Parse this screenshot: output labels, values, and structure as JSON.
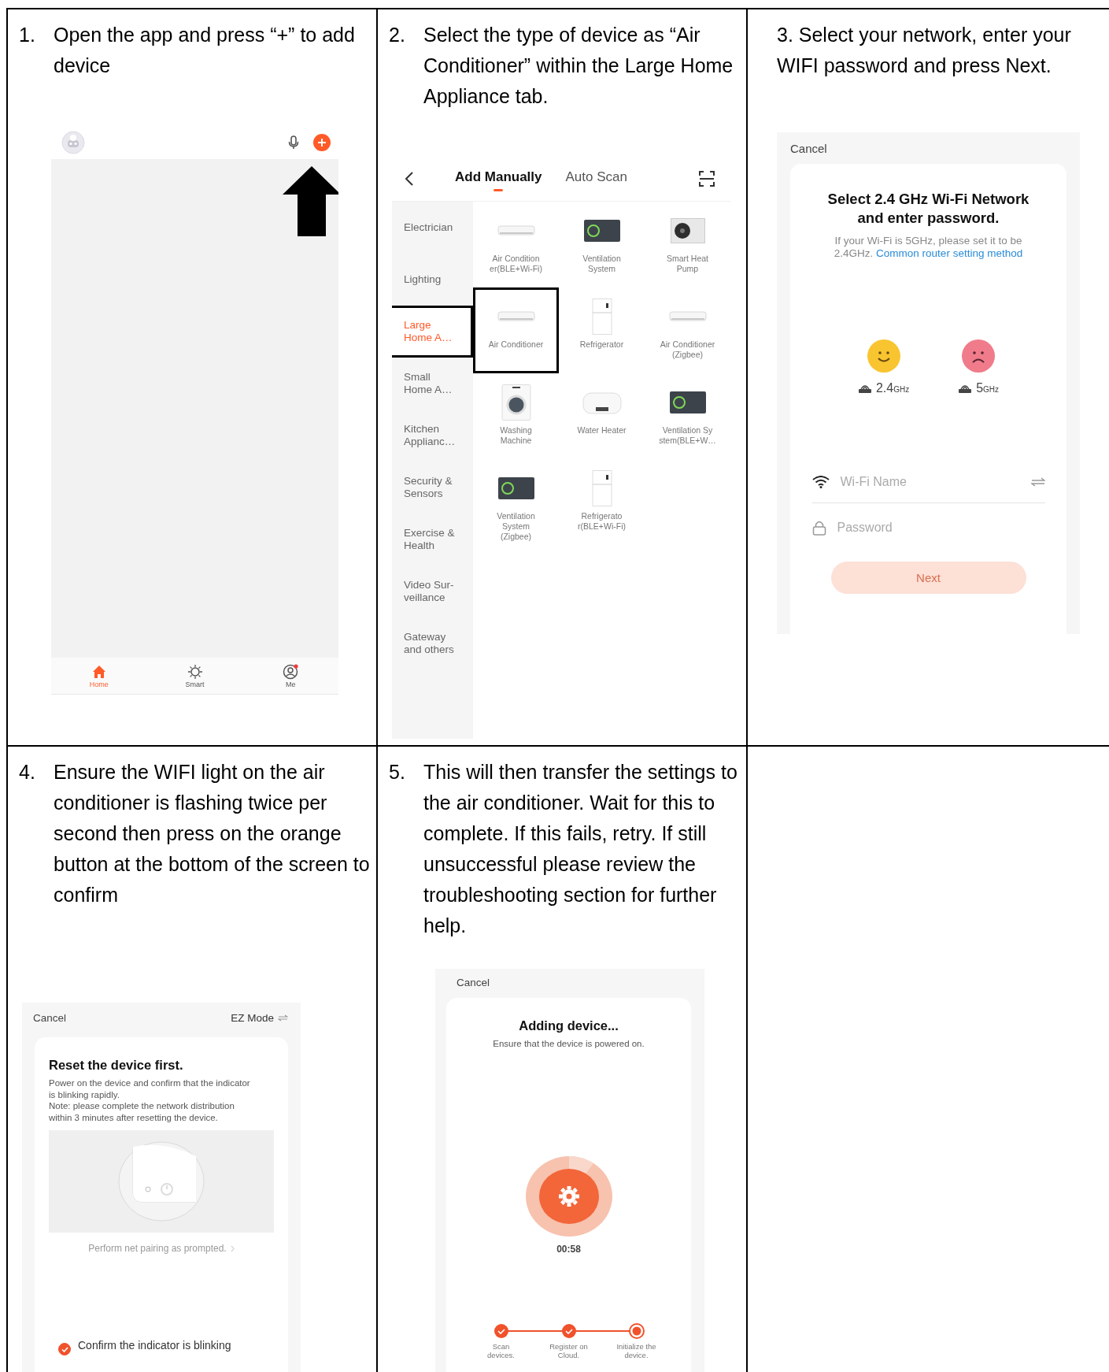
{
  "steps": [
    {
      "number": "1.",
      "text": "Open the app and press “+” to add device",
      "screen": {
        "kind": "home",
        "tabs": [
          {
            "label": "Home",
            "selected": true
          },
          {
            "label": "Smart",
            "selected": false
          },
          {
            "label": "Me",
            "selected": false
          }
        ]
      }
    },
    {
      "number": "2.",
      "text": "Select the type of device as “Air Conditioner” within the Large Home Appliance tab.",
      "screen": {
        "kind": "add_device",
        "tabs": [
          {
            "label": "Add Manually",
            "selected": true
          },
          {
            "label": "Auto Scan",
            "selected": false
          }
        ],
        "categories": [
          {
            "label": "Electrician",
            "selected": false,
            "highlighted": false
          },
          {
            "label": "Lighting",
            "selected": false,
            "highlighted": false
          },
          {
            "label": "Large\nHome A…",
            "selected": true,
            "highlighted": true
          },
          {
            "label": "Small\nHome A…",
            "selected": false,
            "highlighted": false
          },
          {
            "label": "Kitchen\nApplianc…",
            "selected": false,
            "highlighted": false
          },
          {
            "label": "Security &\nSensors",
            "selected": false,
            "highlighted": false
          },
          {
            "label": "Exercise &\nHealth",
            "selected": false,
            "highlighted": false
          },
          {
            "label": "Video Sur-\nveillance",
            "selected": false,
            "highlighted": false
          },
          {
            "label": "Gateway\nand others",
            "selected": false,
            "highlighted": false
          }
        ],
        "devices": [
          {
            "label": "Air Condition\ner(BLE+Wi-Fi)",
            "kind": "ac",
            "highlighted": false
          },
          {
            "label": "Ventilation\nSystem",
            "kind": "vent",
            "highlighted": false
          },
          {
            "label": "Smart Heat\nPump",
            "kind": "pump",
            "highlighted": false
          },
          {
            "label": "Air Conditioner",
            "kind": "ac",
            "highlighted": true
          },
          {
            "label": "Refrigerator",
            "kind": "fridge",
            "highlighted": false
          },
          {
            "label": "Air Conditioner\n(Zigbee)",
            "kind": "ac",
            "highlighted": false
          },
          {
            "label": "Washing\nMachine",
            "kind": "washer",
            "highlighted": false
          },
          {
            "label": "Water Heater",
            "kind": "heater",
            "highlighted": false
          },
          {
            "label": "Ventilation Sy\nstem(BLE+W…",
            "kind": "vent",
            "highlighted": false
          },
          {
            "label": "Ventilation\nSystem\n(Zigbee)",
            "kind": "vent",
            "highlighted": false
          },
          {
            "label": "Refrigerato\nr(BLE+Wi-Fi)",
            "kind": "fridge",
            "highlighted": false
          }
        ]
      }
    },
    {
      "text": "3. Select your network, enter your WIFI password and press Next.",
      "screen": {
        "kind": "wifi",
        "cancel": "Cancel",
        "title": "Select 2.4 GHz Wi-Fi Network and enter password.",
        "hint": "If your Wi-Fi is 5GHz, please set it to be 2.4GHz.",
        "hint_link": "Common router setting method",
        "bands": [
          {
            "value": "2.4",
            "unit": "GHz",
            "ok": true
          },
          {
            "value": "5",
            "unit": "GHz",
            "ok": false
          }
        ],
        "wifi_field": {
          "placeholder": "Wi-Fi Name"
        },
        "password_field": {
          "placeholder": "Password"
        },
        "next_button": {
          "label": "Next",
          "disabled": true
        }
      }
    },
    {
      "number": "4.",
      "text": "Ensure the WIFI light on the air conditioner is flashing twice per second then press on the orange button at the bottom of the screen to confirm",
      "screen": {
        "kind": "reset",
        "cancel": "Cancel",
        "mode": "EZ Mode",
        "title": "Reset the device first.",
        "body": "Power on the device and confirm that the indicator is blinking rapidly.\nNote: please complete the network distribution within 3 minutes after resetting the device.",
        "link": "Perform net pairing as prompted.",
        "confirm": {
          "label": "Confirm the indicator is blinking",
          "checked": true
        }
      }
    },
    {
      "number": "5.",
      "text": "This will then transfer the settings to the air conditioner. Wait for this to complete. If this fails, retry. If still unsuccessful please review the troubleshooting section for further help.",
      "screen": {
        "kind": "adding",
        "cancel": "Cancel",
        "title": "Adding device...",
        "subtitle": "Ensure that the device is powered on.",
        "timer": "00:58",
        "progress": [
          {
            "label": "Scan\ndevices.",
            "done": true
          },
          {
            "label": "Register on\nCloud.",
            "done": true
          },
          {
            "label": "Initialize the\ndevice.",
            "done": false
          }
        ]
      }
    }
  ]
}
